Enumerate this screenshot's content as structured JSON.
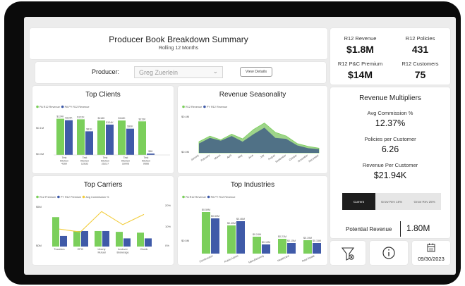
{
  "header": {
    "title": "Producer Book Breakdown Summary",
    "subtitle": "Rolling 12 Months"
  },
  "filter": {
    "label": "Producer:",
    "value": "Greg Zuerlein",
    "button": "View Details"
  },
  "kpis": [
    {
      "label": "R12 Revenue",
      "value": "$1.8M"
    },
    {
      "label": "R12 Policies",
      "value": "431"
    },
    {
      "label": "R12 P&C Premium",
      "value": "$14M"
    },
    {
      "label": "R12 Customers",
      "value": "75"
    }
  ],
  "multipliers": {
    "title": "Revenue Multipliers",
    "items": [
      {
        "label": "Avg Commission %",
        "value": "12.37%"
      },
      {
        "label": "Policies per Customer",
        "value": "6.26"
      },
      {
        "label": "Revenue Per Customer",
        "value": "$21.94K"
      }
    ],
    "segments": [
      "Current",
      "Grow Rev 15%",
      "Grow Rev 25%"
    ],
    "potential_label": "Potential Revenue",
    "potential_value": "1.80M"
  },
  "date_value": "09/30/2023",
  "icons": [
    "filter-reset-icon",
    "info-icon",
    "calendar-icon"
  ],
  "colors": {
    "green": "#7bcf5b",
    "blue": "#3f5aa8",
    "yellow": "#f2cc3a",
    "area_green": "#9ed48a",
    "area_blue": "#4c6b86"
  },
  "chart_data": [
    {
      "id": "clients",
      "type": "bar",
      "title": "Top Clients",
      "legend": [
        "PA R12 Revenue",
        "PA PY R12 Revenue"
      ],
      "categories": [
        "Test Kitchen 4260",
        "Test Kitchen 12632",
        "Test Kitchen 25217",
        "Test Kitchen 16005",
        "Test Kitchen 9566"
      ],
      "series": [
        {
          "name": "PA R12 Revenue",
          "values": [
            124,
            122,
            118,
            118,
            115
          ]
        },
        {
          "name": "PA PY R12 Revenue",
          "values": [
            119,
            81,
            104,
            90,
            5
          ]
        }
      ],
      "data_labels": [
        "$124K",
        "$119K",
        "$122K",
        "$81K",
        "$118K",
        "$104K",
        "$118K",
        "$90K",
        "$115K",
        "$5K"
      ],
      "yticks": [
        "$0.1M",
        "$0.0M"
      ],
      "ylim": [
        0,
        135
      ]
    },
    {
      "id": "season",
      "type": "area",
      "title": "Revenue Seasonality",
      "legend": [
        "R12 Revenue",
        "PY R12 Revenue"
      ],
      "categories": [
        "January",
        "February",
        "March",
        "April",
        "May",
        "June",
        "July",
        "August",
        "September",
        "October",
        "November",
        "December"
      ],
      "series": [
        {
          "name": "R12 Revenue",
          "values": [
            0.12,
            0.18,
            0.14,
            0.2,
            0.15,
            0.25,
            0.32,
            0.22,
            0.18,
            0.1,
            0.07,
            0.05
          ]
        },
        {
          "name": "PY R12 Revenue",
          "values": [
            0.1,
            0.16,
            0.13,
            0.18,
            0.12,
            0.2,
            0.27,
            0.16,
            0.15,
            0.08,
            0.05,
            0.04
          ]
        }
      ],
      "yticks": [
        "$0.4M",
        "$0.0M"
      ],
      "ylim": [
        0,
        0.4
      ]
    },
    {
      "id": "carriers",
      "type": "bar",
      "title": "Top Carriers",
      "legend": [
        "R12 Premium",
        "PY R12 Premium",
        "Avg Commission %"
      ],
      "categories": [
        "Travelers",
        "EPIC",
        "Liberty Mutual",
        "Andover Brokerage",
        "Chubb"
      ],
      "series": [
        {
          "name": "R12 Premium",
          "values": [
            3.6,
            1.9,
            1.9,
            1.8,
            1.7
          ]
        },
        {
          "name": "PY R12 Premium",
          "values": [
            1.3,
            1.9,
            1.9,
            1.0,
            1.0
          ]
        },
        {
          "name": "Avg Commission %",
          "values": [
            12,
            10,
            24,
            15,
            22
          ]
        }
      ],
      "yticks": [
        "$5M",
        "$0M"
      ],
      "y2ticks": [
        "20%",
        "10%",
        "0%"
      ],
      "ylim": [
        0,
        5
      ],
      "y2lim": [
        0,
        28
      ]
    },
    {
      "id": "industries",
      "type": "bar",
      "title": "Top Industries",
      "legend": [
        "PA R12 Revenue",
        "PA PY R12 Revenue"
      ],
      "categories": [
        "Construction",
        "Public Admin",
        "Manufacturing",
        "Healthcare",
        "Real Estate"
      ],
      "series": [
        {
          "name": "PA R12 Revenue",
          "values": [
            0.59,
            0.4,
            0.24,
            0.21,
            0.19
          ]
        },
        {
          "name": "PA PY R12 Revenue",
          "values": [
            0.5,
            0.46,
            0.13,
            0.15,
            0.15
          ]
        }
      ],
      "data_labels": [
        "$0.59M",
        "$0.50M",
        "$0.40M",
        "$0.46M",
        "$0.24M",
        "$0.13M",
        "$0.21M",
        "$0.15M",
        "$0.19M",
        "$0.15M"
      ],
      "yticks": [
        "$0.5M"
      ],
      "ylim": [
        0,
        0.7
      ]
    }
  ]
}
